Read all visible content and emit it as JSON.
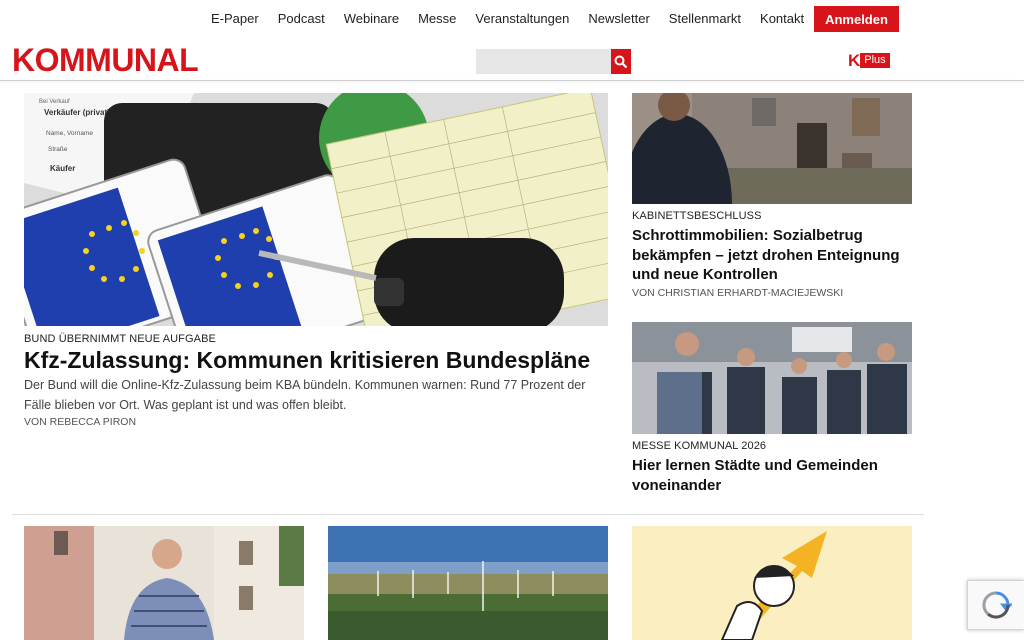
{
  "topnav": {
    "links": [
      "E-Paper",
      "Podcast",
      "Webinare",
      "Messe",
      "Veranstaltungen",
      "Newsletter",
      "Stellenmarkt",
      "Kontakt"
    ],
    "login_label": "Anmelden"
  },
  "brand": {
    "logo_text": "KOMMUNAL",
    "kplus_k": "K",
    "kplus_label": "Plus",
    "accent_color": "#d7141a"
  },
  "search": {
    "placeholder": ""
  },
  "lead": {
    "kicker": "BUND ÜBERNIMMT NEUE AUFGABE",
    "title": "Kfz-Zulassung: Kommunen kritisieren Bundespläne",
    "teaser": "Der Bund will die Online-Kfz-Zulassung beim KBA bündeln. Kommunen warnen: Rund 77 Prozent der Fälle blieben vor Ort. Was geplant ist und was offen bleibt.",
    "byline": "VON REBECCA PIRON",
    "image_labels": {
      "form_seller": "Verkäufer (privat)",
      "form_name": "Name, Vorname",
      "form_street": "Straße",
      "form_buyer": "Käufer"
    }
  },
  "side": [
    {
      "kicker": "KABINETTSBESCHLUSS",
      "title": "Schrottimmobilien: Sozialbetrug bekämpfen – jetzt drohen Enteignung und neue Kontrollen",
      "byline": "VON CHRISTIAN ERHARDT-MACIEJEWSKI"
    },
    {
      "kicker": "MESSE KOMMUNAL 2026",
      "title": "Hier lernen Städte und Gemeinden voneinander"
    }
  ],
  "icons": {
    "search": "search-icon",
    "recaptcha": "recaptcha-icon"
  }
}
